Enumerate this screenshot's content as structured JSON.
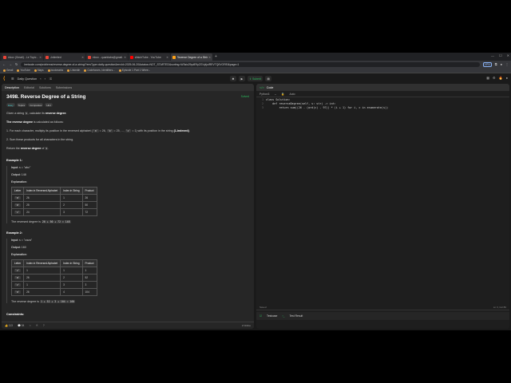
{
  "browser": {
    "tabs": [
      {
        "label": "Inbox (Gmail) - Le Topic - Gmail",
        "color": "#ea4335"
      },
      {
        "label": "Unlimited",
        "color": "#ea4335"
      },
      {
        "label": "Inbox - quarklabs@gmail.com",
        "color": "#ea4335"
      },
      {
        "label": "WatchTube - YouTube",
        "color": "#ff0000"
      },
      {
        "label": "Reverse Degree of a String - LeetCode",
        "color": "#ffa116"
      }
    ],
    "url": "leetcode.com/problems/reverse-degree-of-a-string/?envType=daily-question&envId=2025-06-20&status=NOT_STARTED&sorting=W3sic29ydE9yZGVyIjoiREVTQ0VOREl&page=1",
    "vpn_label": "VPN",
    "bookmarks": [
      "Gmail",
      "YouTube",
      "Maps",
      "bookmarks",
      "LinkedIn",
      "Codeforces, Identifiers...",
      "Episode 1 Part 1 Whee..."
    ]
  },
  "lc_nav": {
    "daily_label": "Daily Question",
    "run_label": "",
    "submit_label": "Submit"
  },
  "left": {
    "tabs": [
      "Description",
      "Editorial",
      "Solutions",
      "Submissions"
    ],
    "title": "3498. Reverse Degree of a String",
    "solved": "Solved",
    "chips": [
      "Easy",
      "Topics",
      "Companies",
      "Hint"
    ],
    "intro_pre": "Given a string ",
    "intro_var": "s",
    "intro_post": ", calculate its ",
    "intro_bold": "reverse degree",
    "def_bold": "The reverse degree",
    "def_rest": " is calculated as follows:",
    "step1": "1. For each character, multiply its position in the reversed alphabet (",
    "step1_a": "'a'",
    "step1_mid": " = 26, ",
    "step1_b": "'b'",
    "step1_mid2": " = 25, ..., ",
    "step1_z": "'z'",
    "step1_end": " = 1) with its position in the string ",
    "step1_bold": "(1-indexed)",
    "step2": "2. Sum these products for all characters in the string.",
    "ret_pre": "Return the ",
    "ret_bold": "reverse degree",
    "ret_mid": " of ",
    "ret_var": "s",
    "example1": {
      "title": "Example 1:",
      "input_label": "Input:",
      "input_value": "s = \"abc\"",
      "output_label": "Output:",
      "output_value": "148",
      "expl_label": "Explanation:",
      "headers": [
        "Letter",
        "Index in Reversed Alphabet",
        "Index in String",
        "Product"
      ],
      "rows": [
        [
          "'a'",
          "26",
          "1",
          "26"
        ],
        [
          "'b'",
          "25",
          "2",
          "50"
        ],
        [
          "'c'",
          "24",
          "3",
          "72"
        ]
      ],
      "summary_pre": "The reversed degree is ",
      "summary_code": "26 + 50 + 72 = 148"
    },
    "example2": {
      "title": "Example 2:",
      "input_label": "Input:",
      "input_value": "s = \"zaza\"",
      "output_label": "Output:",
      "output_value": "160",
      "expl_label": "Explanation:",
      "headers": [
        "Letter",
        "Index in Reversed Alphabet",
        "Index in String",
        "Product"
      ],
      "rows": [
        [
          "'z'",
          "1",
          "1",
          "1"
        ],
        [
          "'a'",
          "26",
          "2",
          "52"
        ],
        [
          "'z'",
          "1",
          "3",
          "3"
        ],
        [
          "'a'",
          "26",
          "4",
          "104"
        ]
      ],
      "summary_pre": "The reverse degree is ",
      "summary_code": "1 + 52 + 3 + 104 = 160"
    },
    "constraints": "Constraints:",
    "status": [
      "113",
      "54",
      "2"
    ],
    "online": "2 Online"
  },
  "right": {
    "tab": "Code",
    "lang": "Python3",
    "auto": "Auto",
    "code": [
      "class Solution:",
      "    def reverseDegree(self, s: str) -> int:",
      "        return sum((26 - (ord(c) - 97)) * (i + 1) for i, c in enumerate(s))"
    ],
    "status_left": "Saved",
    "status_right": "Ln 3, Col 80",
    "bottom_tabs": [
      "Testcase",
      "Test Result"
    ]
  }
}
